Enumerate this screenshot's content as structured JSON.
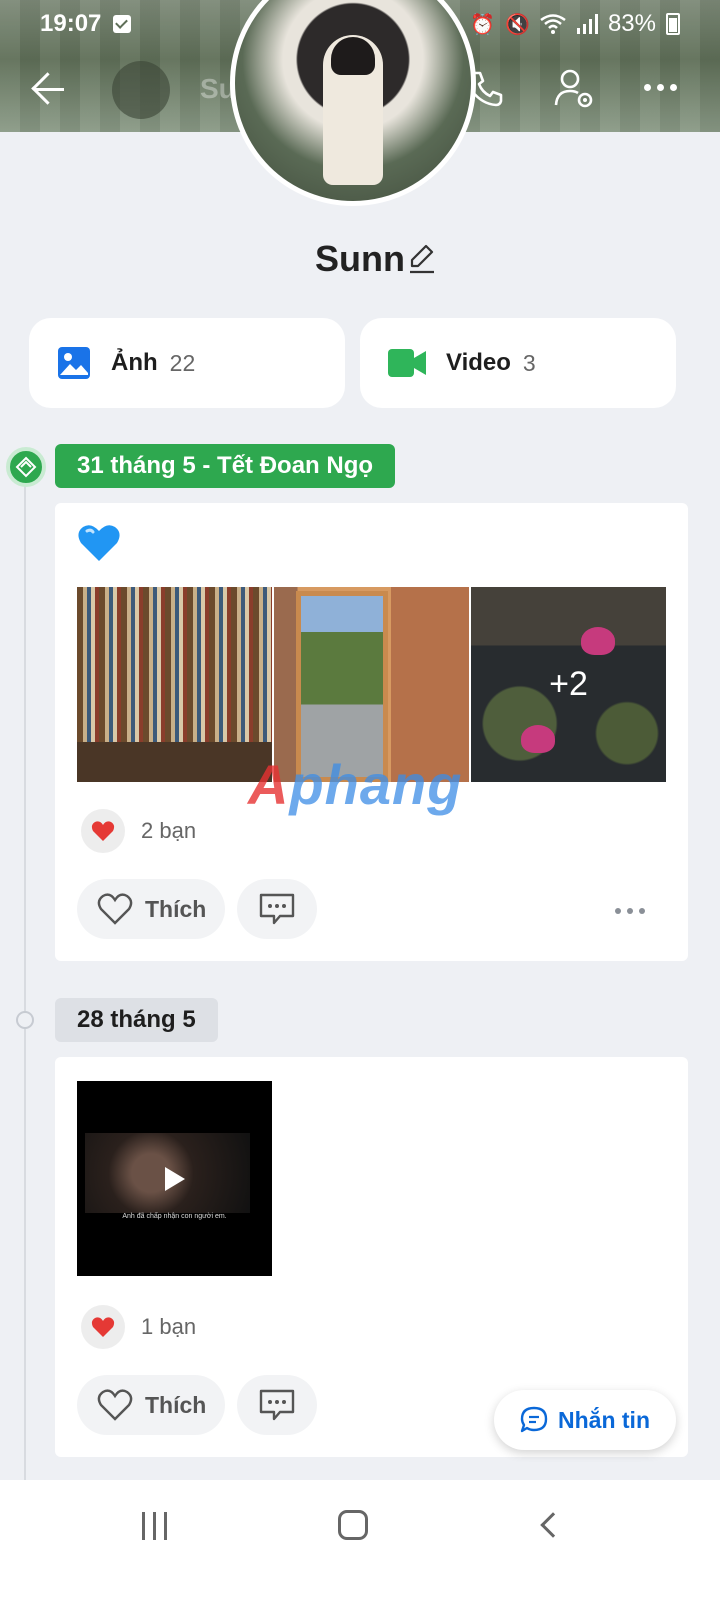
{
  "status_bar": {
    "time": "19:07",
    "battery": "83%"
  },
  "header": {
    "mini_name": "Sunn"
  },
  "profile": {
    "name": "Sunn"
  },
  "albums": [
    {
      "label": "Ảnh",
      "count": "22"
    },
    {
      "label": "Video",
      "count": "3"
    }
  ],
  "posts": [
    {
      "date": "31 tháng 5 - Tết Đoan Ngọ",
      "more_photos": "+2",
      "reactions": "2 bạn",
      "like_label": "Thích"
    },
    {
      "date": "28 tháng 5",
      "video_caption": "Anh đã chấp nhận con người em.",
      "reactions": "1 bạn",
      "like_label": "Thích"
    }
  ],
  "message_button": {
    "label": "Nhắn tin"
  },
  "watermark": {
    "part1": "A",
    "part2": "phang"
  },
  "colors": {
    "accent_green": "#2ea84f",
    "accent_blue": "#0a68d8",
    "video_green": "#2fb55a",
    "photo_blue": "#1a73e8"
  }
}
